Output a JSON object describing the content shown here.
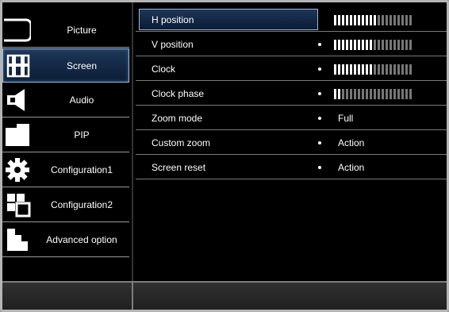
{
  "menu": {
    "items": [
      {
        "label": "Picture",
        "icon": "picture-icon"
      },
      {
        "label": "Screen",
        "icon": "screen-icon",
        "active": true
      },
      {
        "label": "Audio",
        "icon": "audio-icon"
      },
      {
        "label": "PIP",
        "icon": "pip-icon"
      },
      {
        "label": "Configuration1",
        "icon": "gear-icon"
      },
      {
        "label": "Configuration2",
        "icon": "configuration2-icon"
      },
      {
        "label": "Advanced option",
        "icon": "advanced-option-icon"
      }
    ]
  },
  "settings": {
    "rows": [
      {
        "name": "H position",
        "type": "bar",
        "level": 0.55
      },
      {
        "name": "V position",
        "type": "bar",
        "level": 0.5
      },
      {
        "name": "Clock",
        "type": "bar",
        "level": 0.5
      },
      {
        "name": "Clock phase",
        "type": "bar",
        "level": 0.1
      },
      {
        "name": "Zoom mode",
        "type": "value",
        "value": "Full"
      },
      {
        "name": "Custom zoom",
        "type": "value",
        "value": "Action"
      },
      {
        "name": "Screen reset",
        "type": "value",
        "value": "Action"
      }
    ]
  },
  "colors": {
    "accent": "#1e3658",
    "highlight_border": "#9fb6d2"
  }
}
